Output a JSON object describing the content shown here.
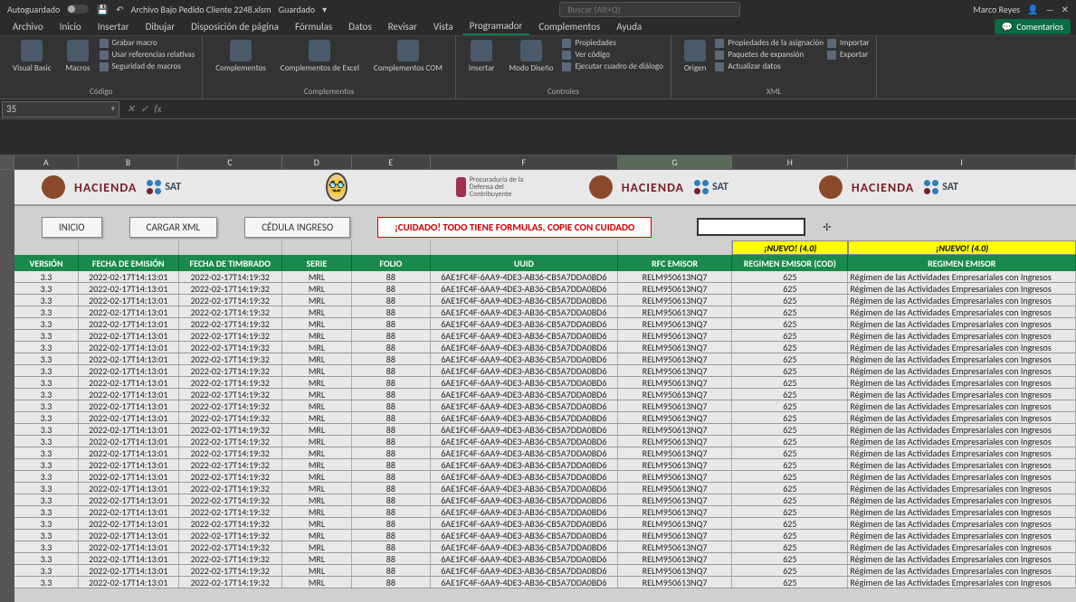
{
  "titlebar": {
    "autosave_label": "Autoguardado",
    "filename": "Archivo Bajo Pedido Cliente 2248.xlsm",
    "saved_state": "Guardado",
    "search_placeholder": "Buscar (Alt+Q)",
    "user": "Marco Reyes"
  },
  "ribbon_tabs": [
    "Archivo",
    "Inicio",
    "Insertar",
    "Dibujar",
    "Disposición de página",
    "Fórmulas",
    "Datos",
    "Revisar",
    "Vista",
    "Programador",
    "Complementos",
    "Ayuda"
  ],
  "active_tab_index": 9,
  "comments_btn": "Comentarios",
  "ribbon": {
    "code": {
      "vb": "Visual\nBasic",
      "macros": "Macros",
      "record": "Grabar macro",
      "refs": "Usar referencias relativas",
      "security": "Seguridad de macros",
      "label": "Código"
    },
    "addins": {
      "app": "Complementos",
      "excel": "Complementos\nde Excel",
      "com": "Complementos\nCOM",
      "label": "Complementos"
    },
    "controls": {
      "insert": "Insertar",
      "design": "Modo\nDiseño",
      "props": "Propiedades",
      "viewcode": "Ver código",
      "rundlg": "Ejecutar cuadro de diálogo",
      "label": "Controles"
    },
    "xml": {
      "source": "Origen",
      "mapprops": "Propiedades de la asignación",
      "expand": "Paquetes de expansión",
      "refresh": "Actualizar datos",
      "import": "Importar",
      "export": "Exportar",
      "label": "XML"
    }
  },
  "name_box": "35",
  "fb_fx": "fx",
  "sheet": {
    "columns": [
      "A",
      "B",
      "C",
      "D",
      "E",
      "F",
      "G",
      "H",
      "I"
    ],
    "selected_col": "G",
    "buttons": {
      "inicio": "INICIO",
      "cargar": "CARGAR XML",
      "cedula": "CÉDULA INGRESO"
    },
    "warning": "¡CUIDADO! TODO TIENE FORMULAS, COPIE CON CUIDADO",
    "nuevo": "¡NUEVO! (4.0)",
    "headers": [
      "VERSIÓN",
      "FECHA DE EMISIÓN",
      "FECHA DE TIMBRADO",
      "SERIE",
      "FOLIO",
      "UUID",
      "RFC EMISOR",
      "REGIMEN EMISOR (COD)",
      "REGIMEN EMISOR"
    ],
    "row_template": {
      "version": "3.3",
      "emision": "2022-02-17T14:13:01",
      "timbrado": "2022-02-17T14:19:32",
      "serie": "MRL",
      "folio": "88",
      "uuid": "6AE1FC4F-6AA9-4DE3-AB36-CB5A7DDA0BD6",
      "rfc": "RELM950613NQ7",
      "regcod": "625",
      "regdesc": "Régimen de las Actividades Empresariales con Ingresos"
    },
    "row_count": 27
  },
  "logos": {
    "hacienda": "HACIENDA",
    "sat": "SAT",
    "prodecon": "Procuraduría\nde la Defensa\ndel Contribuyente"
  }
}
